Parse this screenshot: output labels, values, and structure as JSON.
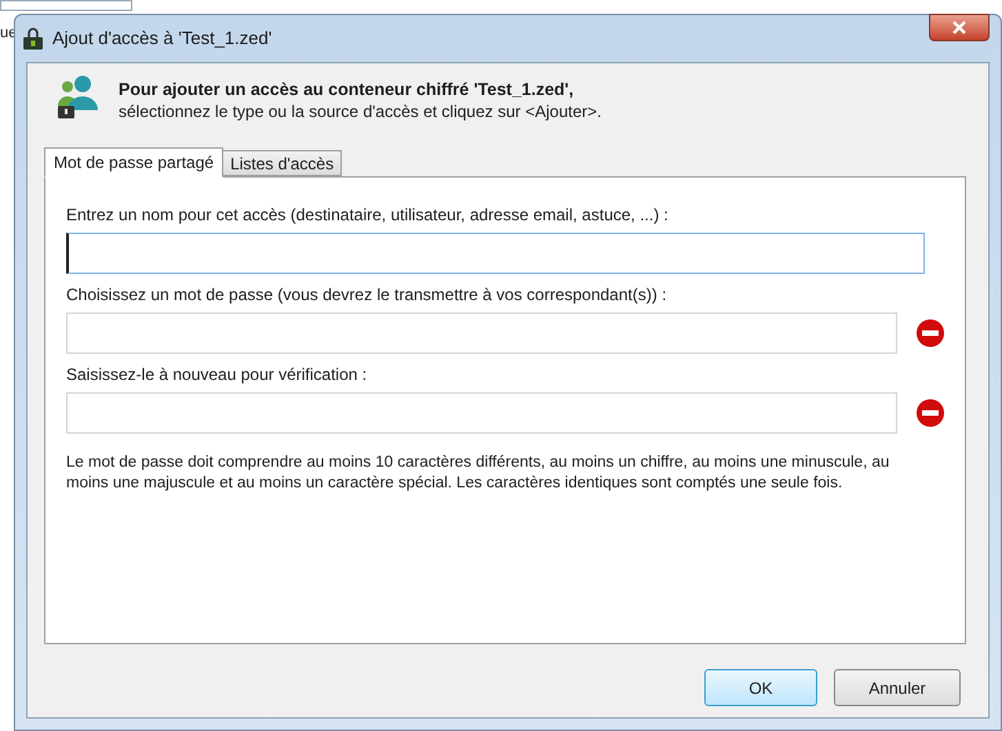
{
  "background_fragment": "ue",
  "window": {
    "title": "Ajout d'accès à 'Test_1.zed'"
  },
  "header": {
    "title": "Pour ajouter un accès au conteneur chiffré 'Test_1.zed',",
    "subtitle": "sélectionnez le type ou la source d'accès et cliquez sur <Ajouter>."
  },
  "tabs": [
    {
      "label": "Mot de passe partagé",
      "selected": true
    },
    {
      "label": "Listes d'accès",
      "selected": false
    }
  ],
  "fields": [
    {
      "label": "Entrez un nom pour cet accès (destinataire, utilisateur, adresse email, astuce, ...) :",
      "focused": true,
      "invalid": false
    },
    {
      "label": "Choisissez un mot de passe (vous devrez le transmettre à vos correspondant(s)) :",
      "focused": false,
      "invalid": true
    },
    {
      "label": "Saisissez-le à nouveau pour vérification :",
      "focused": false,
      "invalid": true
    }
  ],
  "note": "Le mot de passe doit comprendre au moins 10 caractères différents, au moins un chiffre, au moins une minuscule, au moins une majuscule et au moins un caractère spécial. Les caractères identiques sont comptés une seule fois.",
  "buttons": [
    {
      "label": "OK",
      "default": true
    },
    {
      "label": "Annuler",
      "default": false
    }
  ]
}
